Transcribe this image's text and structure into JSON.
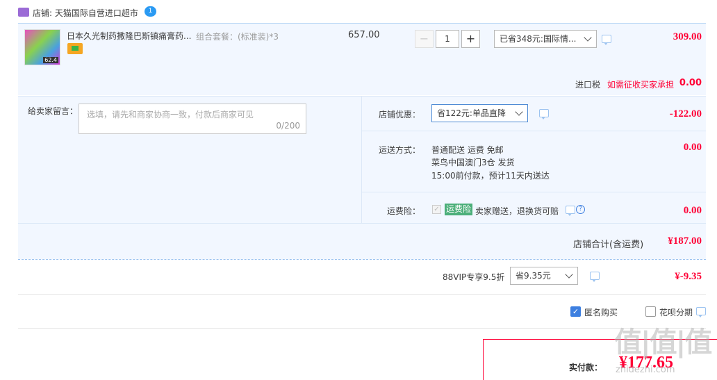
{
  "shop": {
    "label": "店铺: 天猫国际自营进口超市",
    "badge_text": "1"
  },
  "item": {
    "title": "日本久光制药撒隆巴斯镇痛膏药...",
    "sku": "组合套餐：(标准装)*3",
    "unit_price": "657.00",
    "quantity": "1",
    "discount_select": "已省348元:国际情...",
    "subtotal": "309.00",
    "image_badge": "62.4"
  },
  "tax": {
    "label": "进口税",
    "note": "如需征收买家承担",
    "value": "0.00"
  },
  "message": {
    "label": "给卖家留言：",
    "placeholder": "选填，请先和商家协商一致，付款后商家可见",
    "counter": "0/200"
  },
  "shop_discount": {
    "label": "店铺优惠：",
    "select": "省122元:单品直降",
    "value": "-122.00"
  },
  "shipping": {
    "label": "运送方式：",
    "line1": "普通配送 运费 免邮",
    "line2": "菜鸟中国澳门3仓  发货",
    "line3": "15:00前付款，预计11天内送达",
    "value": "0.00"
  },
  "insurance": {
    "label": "运费险：",
    "tag": "运费险",
    "text": "卖家赠送，退换货可赔",
    "value": "0.00"
  },
  "shop_total": {
    "label": "店铺合计(含运费)",
    "value": "¥187.00"
  },
  "vip": {
    "label": "88VIP专享9.5折",
    "select": "省9.35元",
    "value": "¥-9.35"
  },
  "options": {
    "anonymous": "匿名购买",
    "installment": "花呗分期"
  },
  "payment": {
    "label": "实付款：",
    "value": "¥177.65"
  },
  "watermark": {
    "text": "值|值|值",
    "sub": "zhidezhi.com"
  },
  "colors": {
    "price_red": "#ff0036",
    "panel_blue": "#f2f7ff",
    "tag_green": "#4caf7a",
    "checkbox_blue": "#3d7fe0"
  }
}
